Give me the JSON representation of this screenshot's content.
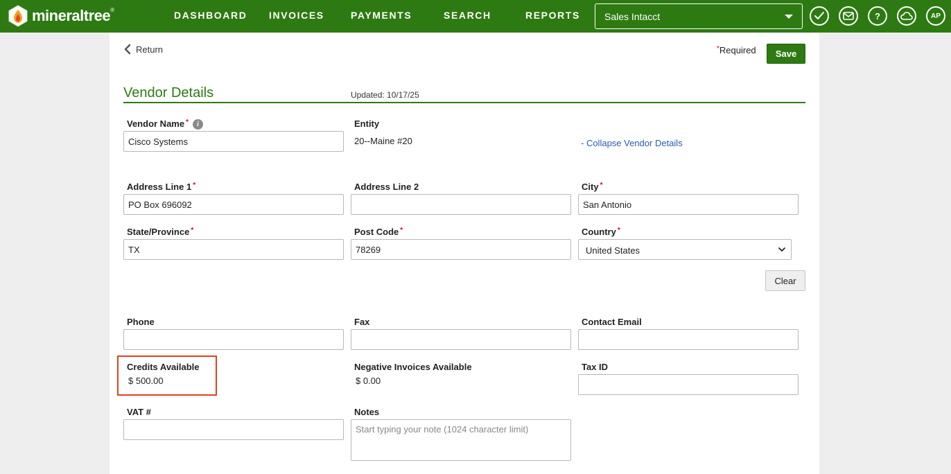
{
  "app": {
    "brand": "mineraltree",
    "brand_mark": "®"
  },
  "nav": {
    "items": [
      {
        "label": "DASHBOARD"
      },
      {
        "label": "INVOICES"
      },
      {
        "label": "PAYMENTS"
      },
      {
        "label": "SEARCH"
      },
      {
        "label": "REPORTS"
      }
    ],
    "entity_selector": "Sales Intacct",
    "user_initials": "AP",
    "help_glyph": "?",
    "icons": [
      "checkmark-icon",
      "mail-icon",
      "help-icon",
      "cloud-icon",
      "user-avatar"
    ]
  },
  "header": {
    "return_label": "Return",
    "required_star": "*",
    "required_label": "Required",
    "save_label": "Save"
  },
  "section": {
    "title": "Vendor Details",
    "updated": "Updated: 10/17/25",
    "collapse_label": "- Collapse Vendor Details"
  },
  "fields": {
    "vendor_name": {
      "label": "Vendor Name",
      "value": "Cisco Systems",
      "info_glyph": "i"
    },
    "entity": {
      "label": "Entity",
      "value": "20--Maine #20"
    },
    "address1": {
      "label": "Address Line 1",
      "value": "PO Box 696092"
    },
    "address2": {
      "label": "Address Line 2",
      "value": ""
    },
    "city": {
      "label": "City",
      "value": "San Antonio"
    },
    "state": {
      "label": "State/Province",
      "value": "TX"
    },
    "post_code": {
      "label": "Post Code",
      "value": "78269"
    },
    "country": {
      "label": "Country",
      "value": "United States"
    },
    "clear_label": "Clear",
    "phone": {
      "label": "Phone",
      "value": ""
    },
    "fax": {
      "label": "Fax",
      "value": ""
    },
    "contact_email": {
      "label": "Contact Email",
      "value": ""
    },
    "credits": {
      "label": "Credits Available",
      "value": "$ 500.00"
    },
    "negative_invoices": {
      "label": "Negative Invoices Available",
      "value": "$ 0.00"
    },
    "tax_id": {
      "label": "Tax ID",
      "value": ""
    },
    "vat": {
      "label": "VAT #",
      "value": ""
    },
    "notes": {
      "label": "Notes",
      "placeholder": "Start typing your note (1024 character limit)"
    }
  },
  "colors": {
    "brand_green": "#2e7a12",
    "required_red": "#d0021b",
    "link_blue": "#2a5da8",
    "highlight": "#e0411b"
  }
}
